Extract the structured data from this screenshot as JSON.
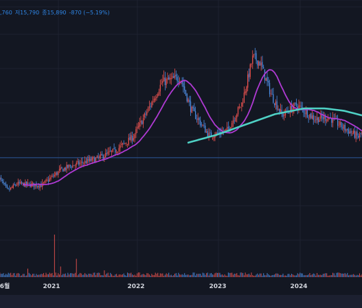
{
  "legend": {
    "close_fragment": ",760",
    "low": "저15,790",
    "close": "종15,890",
    "change": "-870 (−5.19%)"
  },
  "colors": {
    "background": "#131722",
    "up": "#ef5350",
    "down": "#4f8fe6",
    "ma_short": "#b03ad4",
    "ma_long": "#4fd1c5",
    "hline": "#2b5a9c",
    "legend_text": "#2f86e6"
  },
  "chart_data": {
    "type": "candlestick",
    "x_ticks": [
      "6월",
      "2021",
      "2022",
      "2023",
      "2024"
    ],
    "y_scale": "price, unlabeled",
    "anchors": [
      {
        "t": 0,
        "price": 12000
      },
      {
        "t": 0.025,
        "price": 10800
      },
      {
        "t": 0.05,
        "price": 11400
      },
      {
        "t": 0.12,
        "price": 11300
      },
      {
        "t": 0.17,
        "price": 12600
      },
      {
        "t": 0.2,
        "price": 13000
      },
      {
        "t": 0.27,
        "price": 13600
      },
      {
        "t": 0.32,
        "price": 14300
      },
      {
        "t": 0.37,
        "price": 15500
      },
      {
        "t": 0.41,
        "price": 17800
      },
      {
        "t": 0.45,
        "price": 20300
      },
      {
        "t": 0.5,
        "price": 20700
      },
      {
        "t": 0.53,
        "price": 17900
      },
      {
        "t": 0.58,
        "price": 15600
      },
      {
        "t": 0.63,
        "price": 16100
      },
      {
        "t": 0.67,
        "price": 18500
      },
      {
        "t": 0.7,
        "price": 22500
      },
      {
        "t": 0.72,
        "price": 22000
      },
      {
        "t": 0.75,
        "price": 19200
      },
      {
        "t": 0.78,
        "price": 17400
      },
      {
        "t": 0.82,
        "price": 18300
      },
      {
        "t": 0.87,
        "price": 17100
      },
      {
        "t": 0.91,
        "price": 17200
      },
      {
        "t": 0.95,
        "price": 16300
      },
      {
        "t": 0.99,
        "price": 15500
      },
      {
        "t": 1,
        "price": 15890
      }
    ],
    "ma_long_anchors": [
      {
        "t": 0.52,
        "price": 15000
      },
      {
        "t": 0.6,
        "price": 15700
      },
      {
        "t": 0.68,
        "price": 16600
      },
      {
        "t": 0.76,
        "price": 17500
      },
      {
        "t": 0.84,
        "price": 18000
      },
      {
        "t": 0.9,
        "price": 18000
      },
      {
        "t": 0.95,
        "price": 17800
      },
      {
        "t": 1,
        "price": 17400
      }
    ],
    "reference_price": 13700,
    "volume_spikes": [
      {
        "t": 0.155,
        "value": 1.0
      },
      {
        "t": 0.215,
        "value": 0.43
      },
      {
        "t": 0.17,
        "value": 0.25
      },
      {
        "t": 0.08,
        "value": 0.2
      },
      {
        "t": 0.29,
        "value": 0.16
      }
    ]
  }
}
